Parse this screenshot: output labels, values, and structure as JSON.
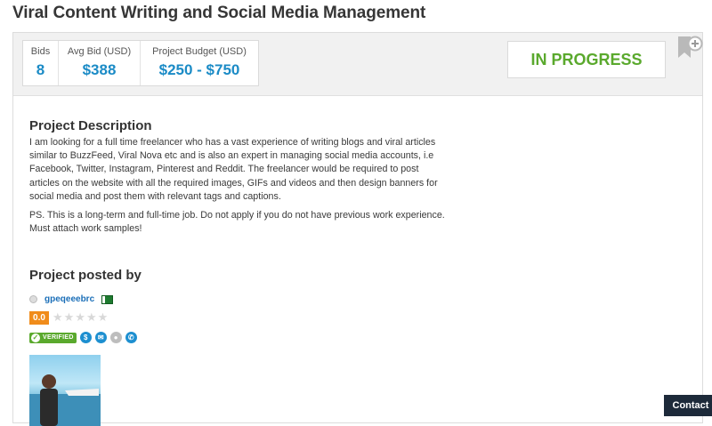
{
  "project": {
    "title": "Viral Content Writing and Social Media Management",
    "status": "IN PROGRESS"
  },
  "stats": [
    {
      "label": "Bids",
      "value": "8"
    },
    {
      "label": "Avg Bid (USD)",
      "value": "$388"
    },
    {
      "label": "Project Budget (USD)",
      "value": "$250 - $750"
    }
  ],
  "description": {
    "heading": "Project Description",
    "paragraphs": [
      "I am looking for a full time freelancer who has a vast experience of writing blogs and viral articles similar to BuzzFeed, Viral Nova etc and is also an expert in managing social media accounts, i.e Facebook, Twitter, Instagram, Pinterest and Reddit. The freelancer would be required to post articles on the website with all the required images, GIFs and videos and then design banners for social media and post them with relevant tags and captions.",
      "PS. This is a long-term and full-time job. Do not apply if you do not have previous work experience. Must attach work samples!"
    ]
  },
  "poster": {
    "heading": "Project posted by",
    "username": "gpeqeeebrc",
    "rating": "0.0",
    "verified_label": "VERIFIED"
  },
  "contact_label": "Contact",
  "icons": {
    "bookmark": "bookmark-add-icon",
    "flag": "flag-icon",
    "verified": "verified-check-icon",
    "payment": "dollar-icon",
    "email": "email-icon",
    "profile": "user-icon",
    "phone": "phone-icon"
  },
  "colors": {
    "accent_blue": "#1b8bc6",
    "status_green": "#5aa92d",
    "rating_orange": "#f08c1b"
  }
}
